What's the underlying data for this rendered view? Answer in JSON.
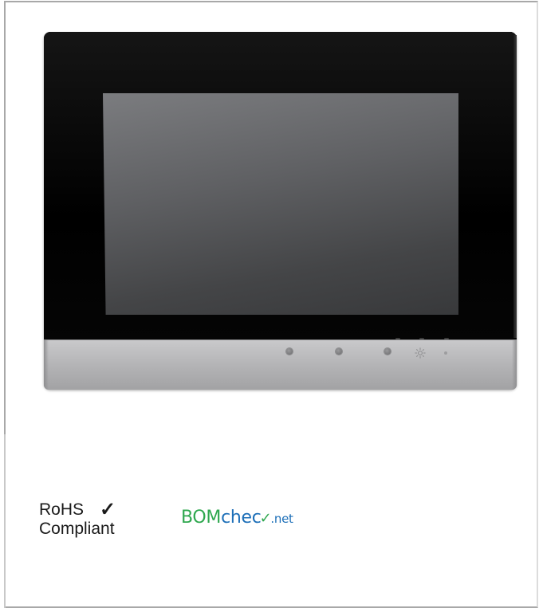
{
  "badges": {
    "rohs": {
      "line1": "RoHS",
      "check": "✓",
      "line2": "Compliant"
    },
    "bomcheck": {
      "part_bom": "BOM",
      "part_check": "chec",
      "check_mark": "✓",
      "part_net": ".net"
    }
  },
  "device": {
    "icons": [
      "brightness-sun-icon"
    ],
    "colors": {
      "bezel": "#000000",
      "screen": "#5f6063",
      "foot": "#b4b4b6"
    }
  }
}
